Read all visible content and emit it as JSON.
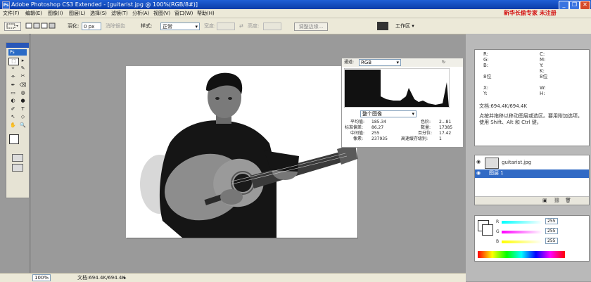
{
  "window": {
    "title": "Adobe Photoshop CS3 Extended - [guitarist.jpg @ 100%(RGB/8#)]",
    "app_badge": "Ps",
    "buttons": [
      "_",
      "❐",
      "✕"
    ]
  },
  "menu": {
    "items": [
      "文件(F)",
      "编辑(E)",
      "图像(I)",
      "图层(L)",
      "选择(S)",
      "滤镜(T)",
      "分析(A)",
      "视图(V)",
      "窗口(W)",
      "帮助(H)"
    ],
    "brand_text": "新华长偷专家  未注册"
  },
  "options_bar": {
    "feather_label": "羽化:",
    "feather_value": "0 px",
    "antialias_label": "消除锯齿",
    "style_label": "样式:",
    "style_value": "正常",
    "width_label": "宽度:",
    "height_label": "高度:",
    "refine_button": "调整边缘...",
    "workspace_label": "工作区 ▾"
  },
  "toolbox": {
    "logo": "Ps",
    "tools": [
      "⬚",
      "▸",
      "⌖",
      "✎",
      "⌯",
      "✂",
      "✒",
      "⌫",
      "▭",
      "◍",
      "◐",
      "●",
      "✐",
      "T",
      "↖",
      "◇",
      "✋",
      "🔍"
    ]
  },
  "histogram": {
    "channel_label": "通道:",
    "channel_value": "RGB",
    "source_value": "整个图像",
    "stats_left": [
      {
        "k": "平均值:",
        "v": "185.34"
      },
      {
        "k": "标准偏差:",
        "v": "86.27"
      },
      {
        "k": "中间值:",
        "v": "255"
      },
      {
        "k": "像素:",
        "v": "237935"
      }
    ],
    "stats_right": [
      {
        "k": "色阶:",
        "v": "2...81"
      },
      {
        "k": "数量:",
        "v": "17385"
      },
      {
        "k": "百分位:",
        "v": "17.42"
      },
      {
        "k": "高速缓存级别:",
        "v": "1"
      }
    ]
  },
  "info_panel": {
    "rows": [
      [
        "R:",
        "C:"
      ],
      [
        "G:",
        "M:"
      ],
      [
        "B:",
        "Y:"
      ],
      [
        "",
        "K:"
      ],
      [
        "8位",
        "8位"
      ],
      [
        "X:",
        "W:"
      ],
      [
        "Y:",
        "H:"
      ]
    ],
    "doc_size": "文档:694.4K/694.4K",
    "hint": "点按并拖移以移动图层或选区。要用附加选项，使用 Shift、Alt 和 Ctrl 键。"
  },
  "layers_panel": {
    "layers": [
      {
        "name": "guitarist.jpg",
        "selected": false
      },
      {
        "name": "图层 1",
        "selected": true
      }
    ]
  },
  "color_panel": {
    "sliders": [
      {
        "label": "R",
        "value": "255",
        "color": "#ff2020"
      },
      {
        "label": "G",
        "value": "255",
        "color": "#20d020"
      },
      {
        "label": "B",
        "value": "255",
        "color": "#2040ff"
      }
    ]
  },
  "status_bar": {
    "zoom": "100%",
    "doc_info": "文档:694.4K/694.4K"
  }
}
